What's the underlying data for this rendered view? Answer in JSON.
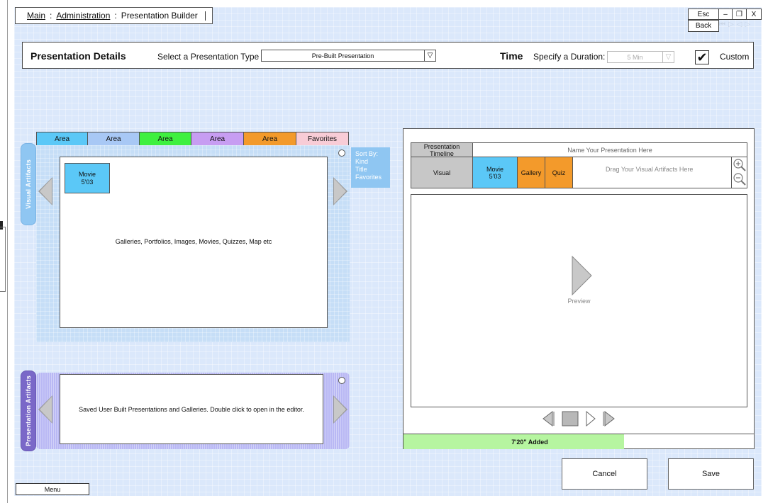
{
  "breadcrumb": {
    "main": "Main",
    "sep1": ":",
    "administration": "Administration",
    "sep2": ":",
    "current": "Presentation Builder"
  },
  "window": {
    "esc": "Esc",
    "back": "Back",
    "minimize": "–",
    "restore": "❐",
    "close": "X"
  },
  "details": {
    "title": "Presentation Details",
    "type_label": "Select a Presentation Type",
    "type_value": "Pre-Built Presentation",
    "time_title": "Time",
    "duration_label": "Specify a Duration:",
    "duration_value": "5 Min",
    "custom_label": "Custom",
    "custom_checked": "✔"
  },
  "tabs": [
    {
      "label": "Area",
      "color": "#5bc8f7"
    },
    {
      "label": "Area",
      "color": "#a8c8f5"
    },
    {
      "label": "Area",
      "color": "#3ff03f"
    },
    {
      "label": "Area",
      "color": "#c79df2"
    },
    {
      "label": "Area",
      "color": "#f39a2b"
    },
    {
      "label": "Favorites",
      "color": "#f8ccd6"
    }
  ],
  "visual_artifacts": {
    "side_label": "Visual Artifacts",
    "chip_title": "Movie",
    "chip_time": "5'03",
    "content_text": "Galleries, Portfolios, Images, Movies, Quizzes, Map etc",
    "sort": {
      "label": "Sort By:",
      "options": [
        "Kind",
        "Title",
        "Favorites"
      ]
    }
  },
  "presentation_artifacts": {
    "side_label": "Presentation Artifacts",
    "content_text": "Saved User Built Presentations and Galleries. Double click to open in the editor."
  },
  "editor": {
    "timeline_label": "Presentation Timeline",
    "name_placeholder": "Name Your Presentation Here",
    "visual_label": "Visual",
    "movie_title": "Movie",
    "movie_time": "5'03",
    "gallery": "Gallery",
    "quiz": "Quiz",
    "drag_hint": "Drag Your Visual Artifacts Here",
    "preview": "Preview",
    "progress_text": "7'20\" Added",
    "progress_fraction": 0.63
  },
  "buttons": {
    "cancel": "Cancel",
    "save": "Save",
    "menu": "Menu"
  },
  "colors": {
    "movie": "#5bc8f7",
    "orange": "#f39a2b",
    "progress": "#b6f5a0",
    "timeline_gray": "#c7c7c7"
  }
}
